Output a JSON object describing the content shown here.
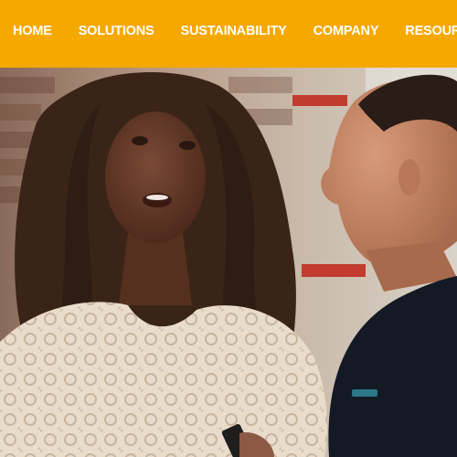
{
  "nav": {
    "items": [
      {
        "label": "HOME"
      },
      {
        "label": "SOLUTIONS"
      },
      {
        "label": "SUSTAINABILITY"
      },
      {
        "label": "COMPANY"
      },
      {
        "label": "RESOURCES"
      }
    ]
  },
  "colors": {
    "nav_background": "#f5a800",
    "nav_text": "#ffffff"
  },
  "hero": {
    "image": "photo-two-people-talking"
  }
}
